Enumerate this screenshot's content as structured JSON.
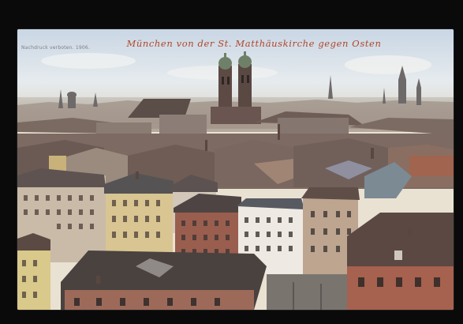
{
  "postcard": {
    "title": "München von der St. Matthäuskirche gegen Osten",
    "imprint": "Nachdruck verboten. 1906."
  },
  "colors": {
    "sky": "#dfe6ee",
    "roof_dark": "#5a4a44",
    "roof_red": "#8a5a4c",
    "caption": "#b0462a"
  }
}
